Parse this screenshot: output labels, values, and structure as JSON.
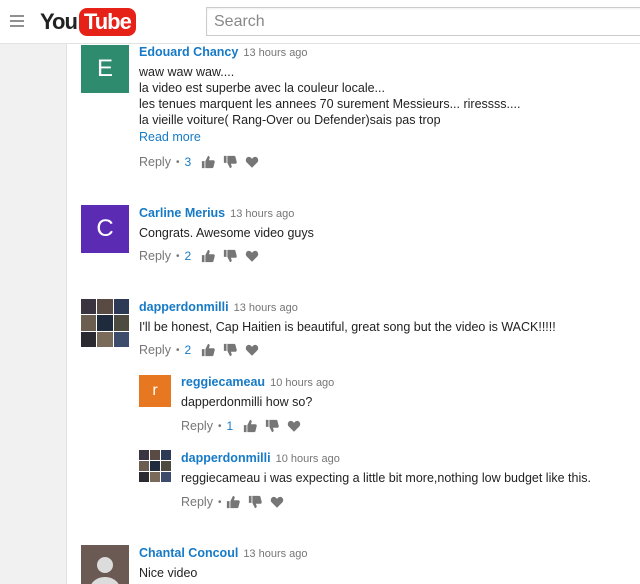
{
  "header": {
    "logo_you": "You",
    "logo_tube": "Tube",
    "search_placeholder": "Search"
  },
  "colors": {
    "accent": "#167ac6",
    "brand_red": "#e62117",
    "avatar_edouard": "#2e8b6e",
    "avatar_carline": "#5b2bb3",
    "avatar_reggie": "#e87722",
    "avatar_chantal": "#6b5a54"
  },
  "comments": [
    {
      "author": "Edouard Chancy",
      "time": "13 hours ago",
      "avatar_letter": "E",
      "lines": [
        "waw waw waw....",
        "la video est superbe avec la couleur locale...",
        "les tenues marquent les annees 70 surement Messieurs... riressss....",
        "la vieille voiture( Rang-Over ou Defender)sais pas trop"
      ],
      "read_more": "Read more",
      "reply": "Reply",
      "likes": "3"
    },
    {
      "author": "Carline Merius",
      "time": "13 hours ago",
      "avatar_letter": "C",
      "lines": [
        "Congrats. Awesome video guys"
      ],
      "reply": "Reply",
      "likes": "2"
    },
    {
      "author": "dapperdonmilli",
      "time": "13 hours ago",
      "lines": [
        "I'll be honest, Cap Haitien is beautiful, great song but the video is WACK!!!!!"
      ],
      "reply": "Reply",
      "likes": "2",
      "replies": [
        {
          "author": "reggiecameau",
          "time": "10 hours ago",
          "avatar_letter": "r",
          "lines": [
            "dapperdonmilli how so?"
          ],
          "reply": "Reply",
          "likes": "1"
        },
        {
          "author": "dapperdonmilli",
          "time": "10 hours ago",
          "lines": [
            "reggiecameau  i was expecting a little bit more,nothing low budget like this."
          ],
          "reply": "Reply"
        }
      ]
    },
    {
      "author": "Chantal Concoul",
      "time": "13 hours ago",
      "lines": [
        "Nice video"
      ]
    }
  ],
  "icons": {
    "menu": "hamburger-menu-icon",
    "like": "thumbs-up-icon",
    "dislike": "thumbs-down-icon",
    "heart": "heart-icon",
    "default_avatar": "person-silhouette-icon"
  }
}
